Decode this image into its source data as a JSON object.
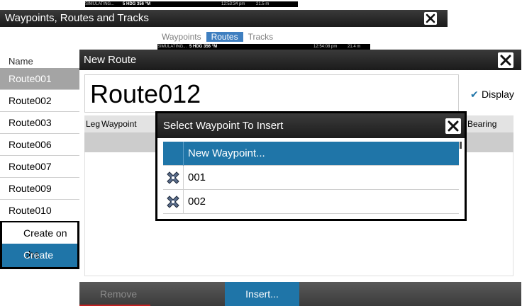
{
  "status_bar_back": {
    "mode": "SIMULATING...",
    "hdg": "5 HDG 356 °M",
    "time": "12:53:34 pm",
    "depth": "21.5 m"
  },
  "status_bar_front": {
    "mode": "SIMULATING...",
    "hdg": "5 HDG 356 °M",
    "time": "12:54:08 pm",
    "depth": "21.4 m"
  },
  "routes_window": {
    "title": "Waypoints, Routes and Tracks",
    "tabs": [
      "Waypoints",
      "Routes",
      "Tracks"
    ],
    "name_header": "Name",
    "routes": [
      "Route001",
      "Route002",
      "Route003",
      "Route006",
      "Route007",
      "Route009",
      "Route010"
    ],
    "create_on_chart_label": "Create on cha",
    "create_using_label": "Create using"
  },
  "new_route_window": {
    "title": "New Route",
    "route_name": "Route012",
    "display_label": "Display",
    "columns": {
      "leg": "Leg",
      "waypoint": "Waypoint",
      "bearing": "Bearing (°M)"
    },
    "remove_label": "Remove",
    "insert_label": "Insert..."
  },
  "select_waypoint_dialog": {
    "title": "Select Waypoint To Insert",
    "items": [
      {
        "label": "New Waypoint...",
        "icon": ""
      },
      {
        "label": "001",
        "icon": "waypoint-marker-icon"
      },
      {
        "label": "002",
        "icon": "waypoint-marker-icon"
      }
    ]
  },
  "colors": {
    "accent": "#1f75a8",
    "selected_row": "#a4a4a4",
    "titlebar": "#2a2a2a",
    "remove_underline": "#c02020"
  }
}
